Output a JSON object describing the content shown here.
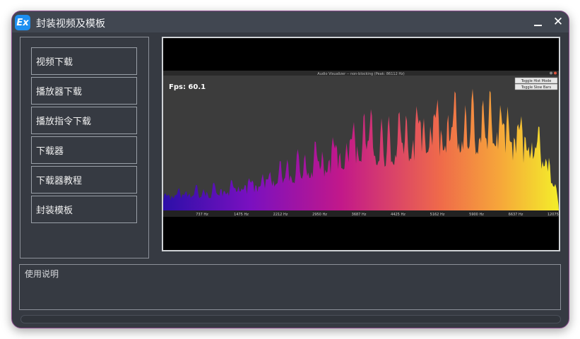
{
  "window": {
    "title": "封装视频及模板",
    "app_icon_text": "Ex",
    "minimize_icon": "minimize-icon",
    "close_icon": "close-icon",
    "close_glyph": "✕"
  },
  "sidebar": {
    "items": [
      {
        "label": "视频下载"
      },
      {
        "label": "播放器下载"
      },
      {
        "label": "播放指令下载"
      },
      {
        "label": "下载器"
      },
      {
        "label": "下载器教程"
      },
      {
        "label": "封装模板"
      }
    ]
  },
  "preview": {
    "window_title": "Audio Visualizer -- non-blocking (Peak: 86112 Hz)",
    "fps": "Fps: 60.1",
    "buttons": [
      "Toggle Hist Mode",
      "Toggle Slow Bars"
    ],
    "freq_labels": [
      "737 Hz",
      "1475 Hz",
      "2212 Hz",
      "2950 Hz",
      "3687 Hz",
      "4425 Hz",
      "5162 Hz",
      "5900 Hz",
      "6637 Hz",
      "12075 H"
    ]
  },
  "description": {
    "label": "使用说明"
  },
  "progress": {
    "value": 0
  }
}
